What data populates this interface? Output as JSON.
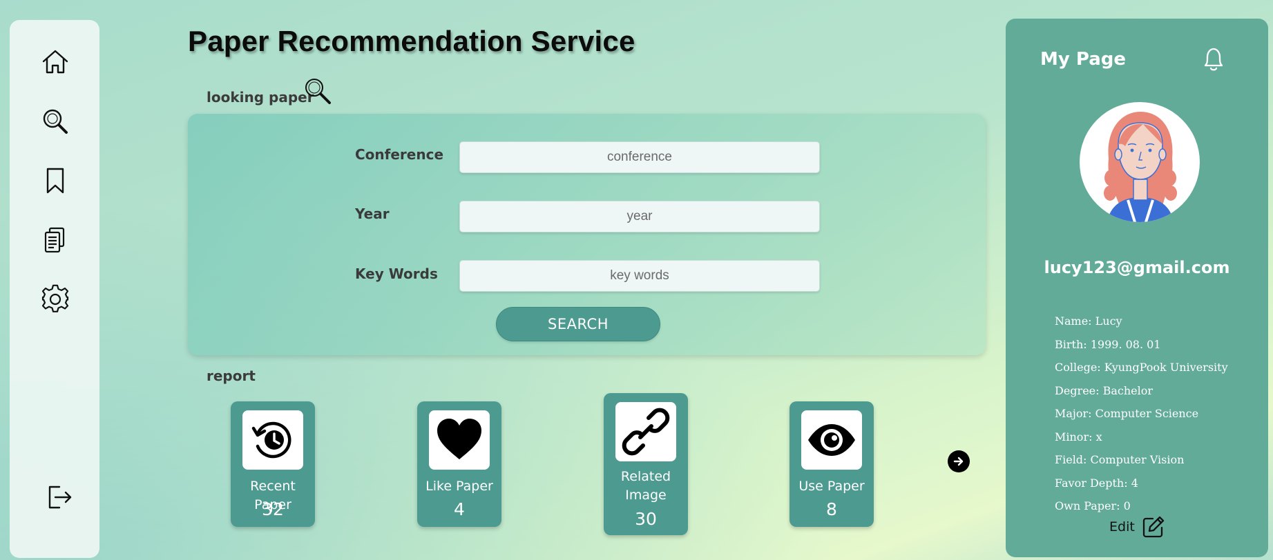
{
  "sidebar": {
    "items": [
      {
        "icon": "home-icon"
      },
      {
        "icon": "search-icon"
      },
      {
        "icon": "bookmark-icon"
      },
      {
        "icon": "documents-icon"
      },
      {
        "icon": "gear-icon"
      }
    ],
    "logout_icon": "logout-icon"
  },
  "main": {
    "title": "Paper Recommendation Service",
    "search_section_label": "looking paper",
    "form": {
      "conference": {
        "label": "Conference",
        "placeholder": "conference",
        "value": ""
      },
      "year": {
        "label": "Year",
        "placeholder": "year",
        "value": ""
      },
      "keywords": {
        "label": "Key Words",
        "placeholder": "key words",
        "value": ""
      },
      "search_button": "SEARCH"
    },
    "report_section_label": "report",
    "reports": [
      {
        "label": "Recent Paper",
        "count": "32",
        "icon": "history-clock-icon"
      },
      {
        "label": "Like Paper",
        "count": "4",
        "icon": "heart-icon"
      },
      {
        "label": "Related Image",
        "count": "30",
        "icon": "link-chain-icon"
      },
      {
        "label": "Use Paper",
        "count": "8",
        "icon": "eye-icon"
      }
    ]
  },
  "profile": {
    "title": "My Page",
    "email": "lucy123@gmail.com",
    "details": [
      "Name: Lucy",
      "Birth: 1999. 08. 01",
      "College: KyungPook University",
      "Degree: Bachelor",
      "Major: Computer Science",
      "Minor: x",
      "Field: Computer Vision",
      "Favor Depth: 4",
      "Own Paper: 0"
    ],
    "edit_label": "Edit"
  },
  "colors": {
    "accent": "#4d9a90",
    "profile_bg": "#62ab98",
    "sidebar_bg": "#eef7f4"
  }
}
